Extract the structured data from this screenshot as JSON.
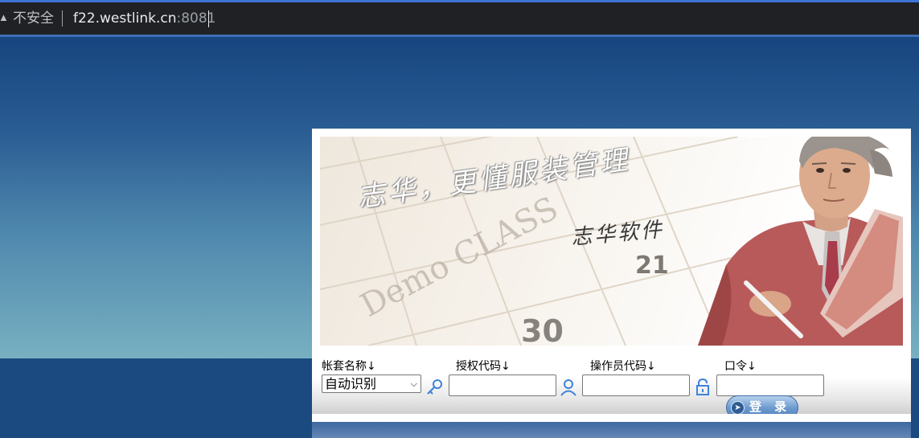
{
  "browser": {
    "security_label": "不安全",
    "url_host": "f22.westlink.cn",
    "url_port": ":8081"
  },
  "banner": {
    "slogan": "志华，更懂服装管理",
    "brand": "志华软件",
    "calendar_text": "Demo CLASS",
    "calendar_numbers": [
      "21",
      "30"
    ]
  },
  "form": {
    "account_label": "帐套名称↓",
    "account_selected": "自动识别",
    "auth_label": "授权代码↓",
    "auth_value": "",
    "operator_label": "操作员代码↓",
    "operator_value": "",
    "password_label": "口令↓",
    "password_value": "",
    "login_label": "登 录"
  }
}
